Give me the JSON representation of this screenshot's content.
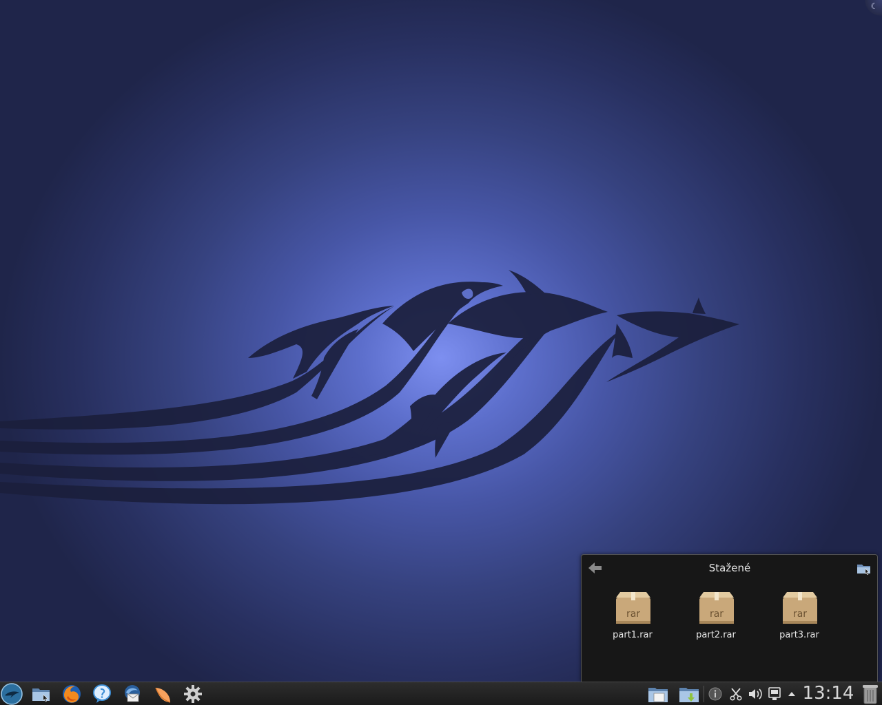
{
  "folder_popup": {
    "title": "Stažené",
    "files": [
      {
        "name": "part1.rar",
        "icon": "rar-archive-icon",
        "badge": "rar"
      },
      {
        "name": "part2.rar",
        "icon": "rar-archive-icon",
        "badge": "rar"
      },
      {
        "name": "part3.rar",
        "icon": "rar-archive-icon",
        "badge": "rar"
      }
    ]
  },
  "panel": {
    "launchers": [
      {
        "name": "kickoff-menu-icon"
      },
      {
        "name": "file-manager-icon"
      },
      {
        "name": "firefox-icon"
      },
      {
        "name": "instant-messenger-icon"
      },
      {
        "name": "email-client-icon"
      },
      {
        "name": "media-player-icon"
      },
      {
        "name": "system-settings-icon"
      }
    ],
    "tray": [
      {
        "name": "folder-view-icon"
      },
      {
        "name": "downloads-folder-icon"
      },
      {
        "name": "info-icon"
      },
      {
        "name": "scissors-icon"
      },
      {
        "name": "volume-icon"
      },
      {
        "name": "network-icon"
      },
      {
        "name": "tray-expand-arrow-icon"
      }
    ],
    "clock": "13:14",
    "trash": {
      "name": "trash-icon"
    }
  },
  "colors": {
    "wallpaper_center": "#7d8ff0",
    "wallpaper_edge": "#1f254a",
    "silhouette": "#1b1f3c",
    "panel_bg": "#222222",
    "popup_bg": "#171717",
    "archive_box": "#c9a87a"
  }
}
